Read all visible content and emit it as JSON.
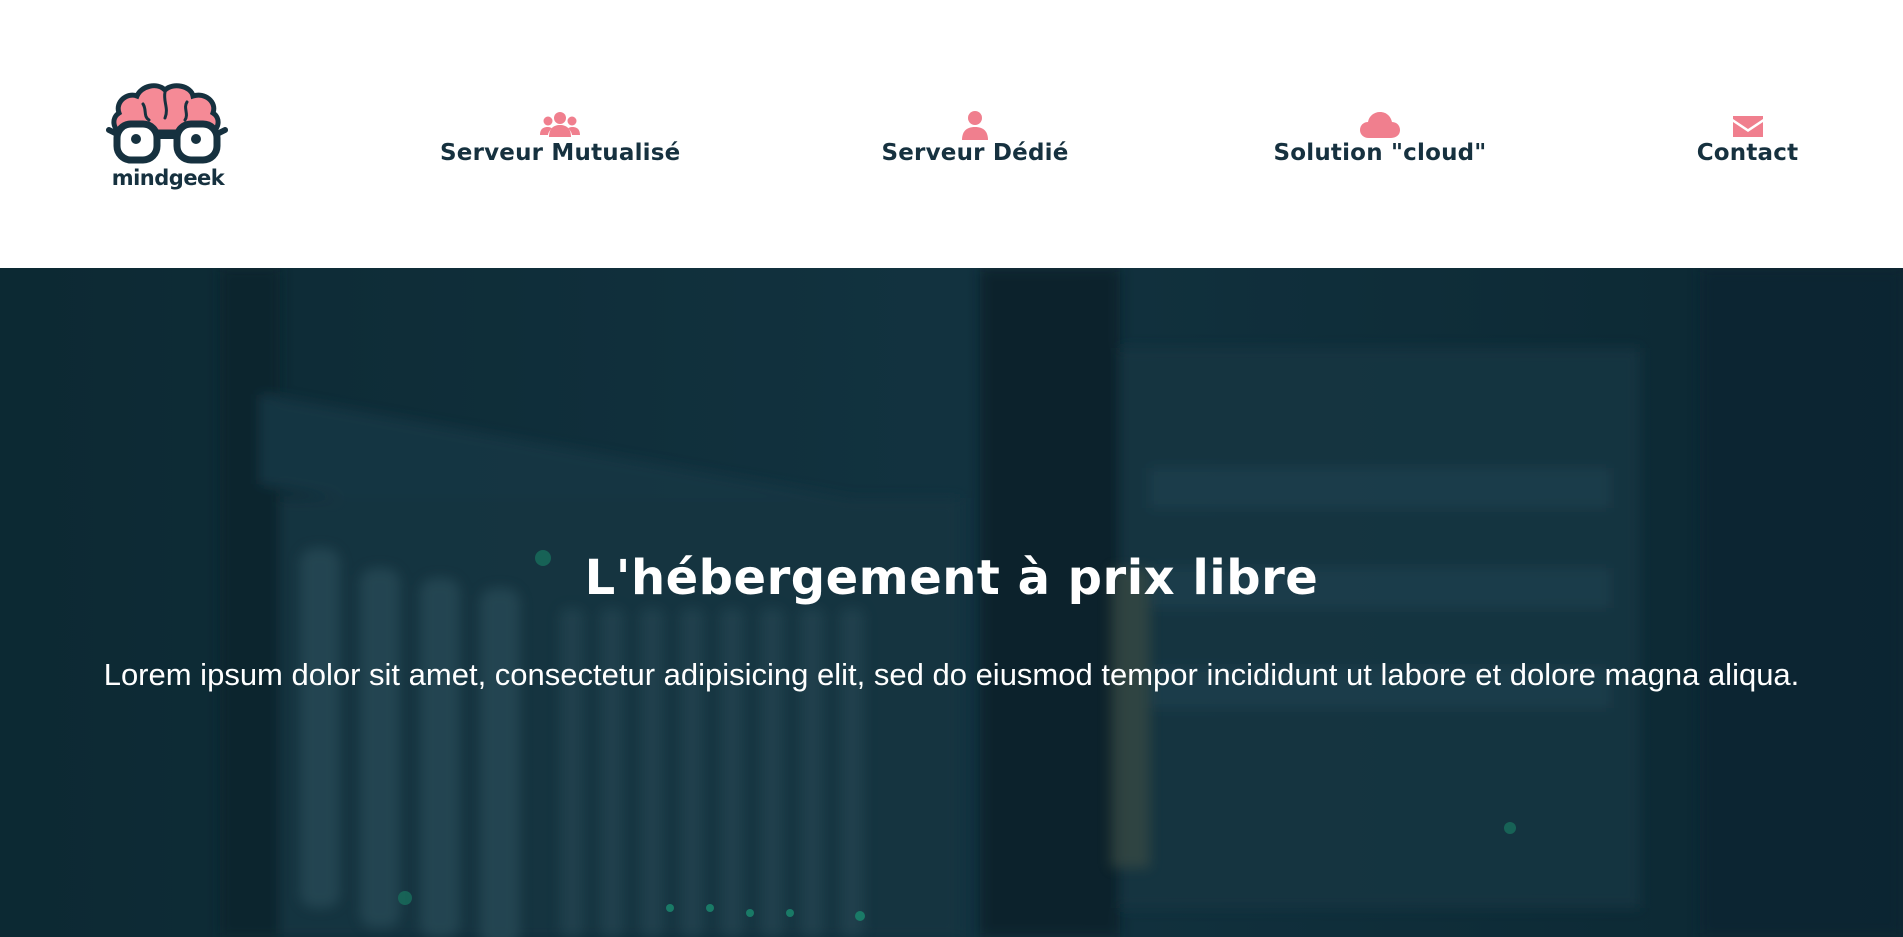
{
  "header": {
    "logo": {
      "text": "mindgeek"
    },
    "nav": [
      {
        "label": "Serveur Mutualisé",
        "icon": "users-icon"
      },
      {
        "label": "Serveur Dédié",
        "icon": "user-icon"
      },
      {
        "label": "Solution \"cloud\"",
        "icon": "cloud-icon"
      },
      {
        "label": "Contact",
        "icon": "envelope-icon"
      }
    ]
  },
  "hero": {
    "title": "L'hébergement à prix libre",
    "text": "Lorem ipsum dolor sit amet, consectetur adipisicing elit, sed do eiusmod tempor incididunt ut labore et dolore magna aliqua.",
    "background": "server-rack-photo"
  },
  "colors": {
    "accent": "#f07f8e",
    "text_dark": "#16313f",
    "hero_overlay": "#0f2b36",
    "white": "#ffffff"
  }
}
